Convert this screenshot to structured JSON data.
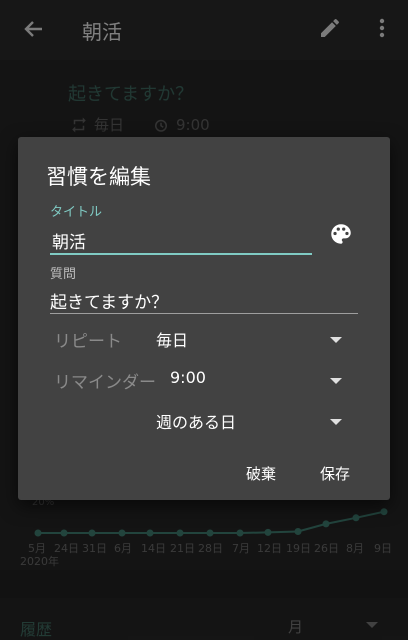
{
  "appbar": {
    "title": "朝活"
  },
  "header": {
    "question": "起きてますか？",
    "repeat": "毎日",
    "time": "9:00"
  },
  "chart": {
    "percent_label": "20%",
    "months": [
      "5月",
      "24日",
      "31日",
      "6月",
      "14日",
      "21日",
      "28日",
      "7月",
      "12日",
      "19日",
      "26日",
      "8月",
      "9日"
    ],
    "year": "2020年"
  },
  "chart_data": {
    "type": "line",
    "y_values_normalized": [
      0,
      0,
      0,
      0,
      0,
      0,
      0,
      0,
      0.02,
      0.05,
      0.3,
      0.5,
      0.7
    ]
  },
  "history": {
    "label": "履歴",
    "value": "月"
  },
  "dialog": {
    "title": "習慣を編集",
    "title_label": "タイトル",
    "title_value": "朝活",
    "question_label": "質問",
    "question_value": "起きてますか？",
    "repeat_label": "リピート",
    "repeat_value": "毎日",
    "reminder_label": "リマインダー",
    "reminder_value": "9:00",
    "weekday_value": "週のある日",
    "discard": "破棄",
    "save": "保存"
  }
}
